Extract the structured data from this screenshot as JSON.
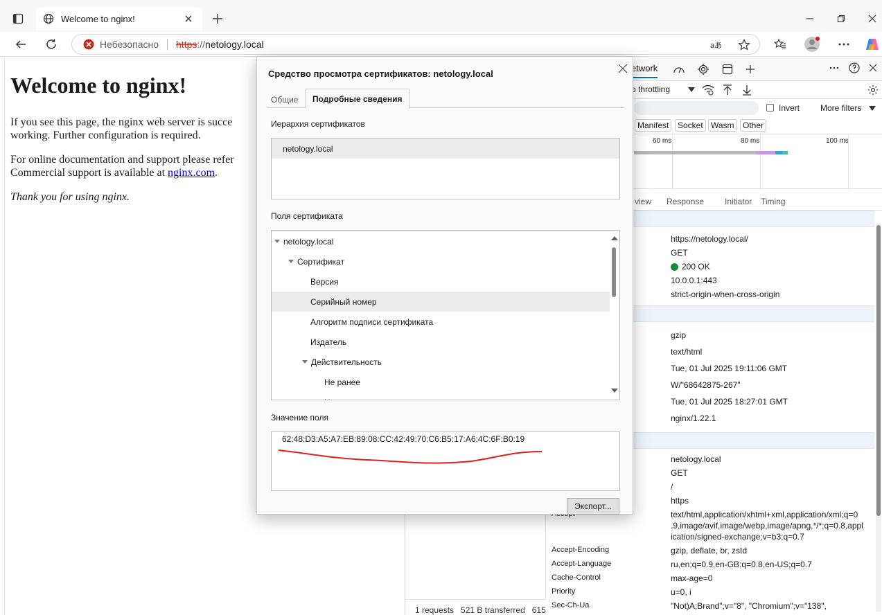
{
  "browser": {
    "tab_title": "Welcome to nginx!",
    "insecure_label": "Небезопасно",
    "url_scheme": "https",
    "url_slashes": "://",
    "url_host": "netology.local"
  },
  "page": {
    "heading": "Welcome to nginx!",
    "p1_line1": "If you see this page, the nginx web server is succe",
    "p1_line2": "working. Further configuration is required.",
    "p2_line1": "For online documentation and support please refer",
    "p2_line2_pre": "Commercial support is available at ",
    "p2_link": "nginx.com",
    "p2_line2_post": ".",
    "p3": "Thank you for using nginx."
  },
  "devtools": {
    "active_tab": "etwork",
    "throttling": "o throttling",
    "invert_label": "Invert",
    "more_filters": "More filters",
    "filter_chips": [
      "Manifest",
      "Socket",
      "Wasm",
      "Other"
    ],
    "timeline_ticks": [
      "60 ms",
      "80 ms",
      "100 ms"
    ],
    "subtabs": [
      "view",
      "Response",
      "Initiator",
      "Timing"
    ],
    "general_values": [
      "https://netology.local/",
      "GET",
      "200 OK",
      "10.0.0.1:443",
      "strict-origin-when-cross-origin"
    ],
    "response_values": [
      "gzip",
      "text/html",
      "Tue, 01 Jul 2025 19:11:06 GMT",
      "W/\"68642875-267\"",
      "Tue, 01 Jul 2025 18:27:01 GMT",
      "nginx/1.22.1"
    ],
    "request_values": [
      "netology.local",
      "GET",
      "/",
      "https"
    ],
    "accept_key": "Accept",
    "accept_value_lines": [
      "text/html,application/xhtml+xml,application/xml;q=0",
      ".9,image/avif,image/webp,image/apng,*/*;q=0.8,appl",
      "ication/signed-exchange;v=b3;q=0.7"
    ],
    "request_headers": [
      {
        "key": "Accept-Encoding",
        "value": "gzip, deflate, br, zstd"
      },
      {
        "key": "Accept-Language",
        "value": "ru,en;q=0.9,en-GB;q=0.8,en-US;q=0.7"
      },
      {
        "key": "Cache-Control",
        "value": "max-age=0"
      },
      {
        "key": "Priority",
        "value": "u=0, i"
      },
      {
        "key": "Sec-Ch-Ua",
        "value": "\"Not)A;Brand\";v=\"8\", \"Chromium\";v=\"138\","
      }
    ],
    "status_bar": "1 requests   521 B transferred   615",
    "status_ok_color": "#1e8a3e"
  },
  "dialog": {
    "title": "Средство просмотра сертификатов: netology.local",
    "tab_general": "Общие",
    "tab_details": "Подробные сведения",
    "hierarchy_label": "Иерархия сертификатов",
    "hierarchy_item": "netology.local",
    "fields_label": "Поля сертификата",
    "tree": [
      {
        "label": "netology.local",
        "level": 0,
        "expanded": true
      },
      {
        "label": "Сертификат",
        "level": 1,
        "expanded": true
      },
      {
        "label": "Версия",
        "level": 2
      },
      {
        "label": "Серийный номер",
        "level": 2,
        "selected": true
      },
      {
        "label": "Алгоритм подписи сертификата",
        "level": 2
      },
      {
        "label": "Издатель",
        "level": 2
      },
      {
        "label": "Действительность",
        "level": 2,
        "expanded": true
      },
      {
        "label": "Не ранее",
        "level": 3
      },
      {
        "label": "Н",
        "level": 3
      }
    ],
    "value_label": "Значение поля",
    "field_value": "62:48:D3:A5:A7:EB:89:08:CC:42:49:70:C6:B5:17:A6:4C:6F:B0:19",
    "export_button": "Экспорт...",
    "annotation_color": "#e02020"
  }
}
